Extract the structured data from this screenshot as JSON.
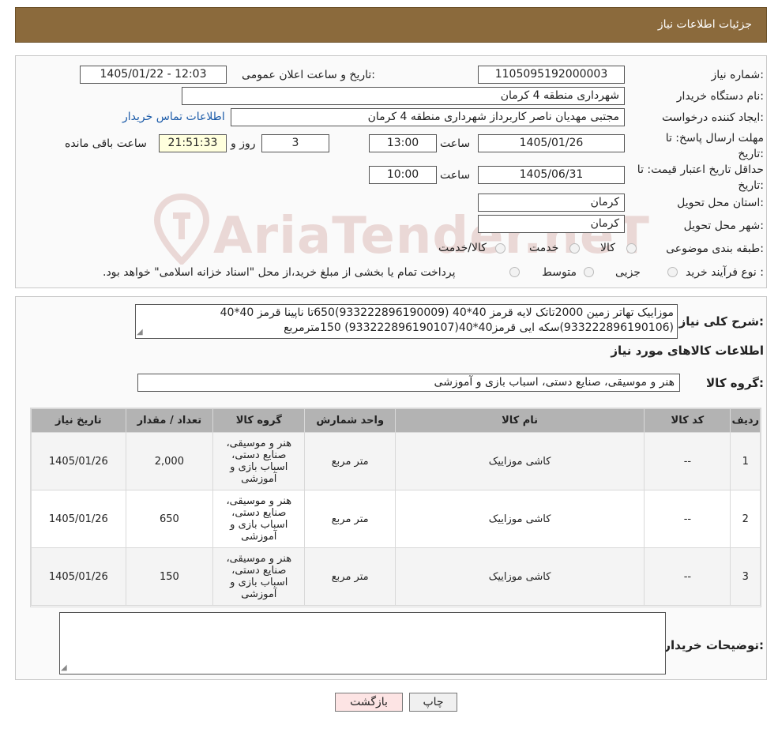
{
  "header": {
    "title": "جزئیات اطلاعات نیاز"
  },
  "watermark": "AriaTender.neT",
  "form": {
    "need_number_label": "شماره نیاز:",
    "need_number": "1105095192000003",
    "announce_label": "تاریخ و ساعت اعلان عمومی:",
    "announce_value": "1405/01/22 - 12:03",
    "buyer_org_label": "نام دستگاه خریدار:",
    "buyer_org": "شهرداری منطقه 4 کرمان",
    "requester_label": "ایجاد کننده درخواست:",
    "requester": "مجتبی مهدیان ناصر کاربرداز شهرداری منطقه 4 کرمان",
    "contact_link": "اطلاعات تماس خریدار",
    "deadline_label": "مهلت ارسال پاسخ: تا تاریخ:",
    "deadline_date": "1405/01/26",
    "time_label": "ساعت",
    "deadline_time": "13:00",
    "days_value": "3",
    "days_label": "روز و",
    "remaining_value": "21:51:33",
    "remaining_label": "ساعت باقی مانده",
    "validity_label": "حداقل تاریخ اعتبار قیمت: تا تاریخ:",
    "validity_date": "1405/06/31",
    "validity_time": "10:00",
    "province_label": "استان محل تحویل:",
    "province": "کرمان",
    "city_label": "شهر محل تحویل:",
    "city": "کرمان",
    "category_label": "طبقه بندی موضوعی:",
    "category_options": [
      "کالا",
      "خدمت",
      "کالا/خدمت"
    ],
    "process_label": "نوع فرآیند خرید :",
    "process_options": [
      "جزیی",
      "متوسط"
    ],
    "process_note": "پرداخت تمام یا بخشی از مبلغ خرید،از محل \"اسناد خزانه اسلامی\" خواهد بود."
  },
  "summary": {
    "label": "شرح کلی نیاز:",
    "text_line1": "موزاییک تهاتر زمین 2000تاتک لایه قرمز 40*40 (933222896190009)650تا ناپینا قرمز 40*40",
    "text_line2": "(933222896190106)سکه ایی قرمز40*40(933222896190107) 150مترمربع",
    "goods_info_title": "اطلاعات کالاهای مورد نیاز",
    "goods_group_label": "گروه کالا:",
    "goods_group_value": "هنر و موسیقی، صنایع دستی، اسباب بازی و آموزشی"
  },
  "table": {
    "headers": [
      "ردیف",
      "کد کالا",
      "نام کالا",
      "واحد شمارش",
      "گروه کالا",
      "تعداد / مقدار",
      "تاریخ نیاز"
    ],
    "rows": [
      [
        "1",
        "--",
        "کاشی موزاییک",
        "متر مربع",
        "هنر و موسیقی، صنایع دستی، اسباب بازی و آموزشی",
        "2,000",
        "1405/01/26"
      ],
      [
        "2",
        "--",
        "کاشی موزاییک",
        "متر مربع",
        "هنر و موسیقی، صنایع دستی، اسباب بازی و آموزشی",
        "650",
        "1405/01/26"
      ],
      [
        "3",
        "--",
        "کاشی موزاییک",
        "متر مربع",
        "هنر و موسیقی، صنایع دستی، اسباب بازی و آموزشی",
        "150",
        "1405/01/26"
      ]
    ]
  },
  "buyer_notes": {
    "label": "توضیحات خریدار:",
    "value": ""
  },
  "buttons": {
    "print": "چاپ",
    "back": "بازگشت"
  }
}
